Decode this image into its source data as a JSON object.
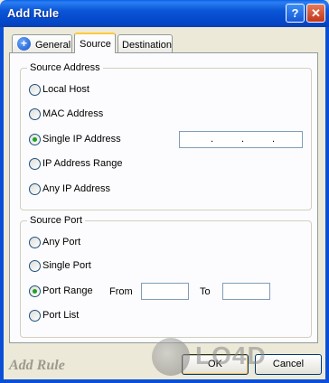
{
  "window": {
    "title": "Add Rule",
    "help_label": "?",
    "close_label": "✕"
  },
  "tabs": [
    {
      "label": "General",
      "icon": "plus-circle-icon"
    },
    {
      "label": "Source",
      "selected": true
    },
    {
      "label": "Destination"
    }
  ],
  "source_address": {
    "legend": "Source Address",
    "options": [
      {
        "label": "Local Host",
        "checked": false
      },
      {
        "label": "MAC Address",
        "checked": false
      },
      {
        "label": "Single IP Address",
        "checked": true
      },
      {
        "label": "IP Address Range",
        "checked": false
      },
      {
        "label": "Any IP Address",
        "checked": false
      }
    ],
    "ip_dots": [
      ".",
      ".",
      "."
    ]
  },
  "source_port": {
    "legend": "Source Port",
    "options": [
      {
        "label": "Any Port",
        "checked": false
      },
      {
        "label": "Single Port",
        "checked": false
      },
      {
        "label": "Port Range",
        "checked": true
      },
      {
        "label": "Port List",
        "checked": false
      }
    ],
    "from_label": "From",
    "to_label": "To",
    "from_value": "",
    "to_value": ""
  },
  "footer": {
    "caption": "Add Rule",
    "ok_label": "OK",
    "cancel_label": "Cancel"
  },
  "watermark": {
    "text": "LO4D"
  }
}
